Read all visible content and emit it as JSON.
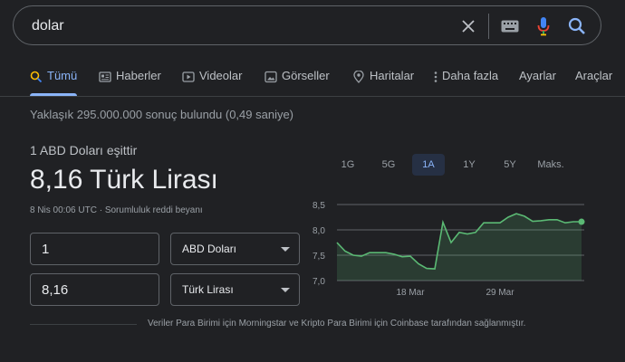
{
  "search": {
    "query": "dolar"
  },
  "tabs": [
    {
      "label": "Tümü",
      "icon": "search-icon",
      "active": true
    },
    {
      "label": "Haberler",
      "icon": "news-icon",
      "active": false
    },
    {
      "label": "Videolar",
      "icon": "video-icon",
      "active": false
    },
    {
      "label": "Görseller",
      "icon": "image-icon",
      "active": false
    },
    {
      "label": "Haritalar",
      "icon": "map-pin-icon",
      "active": false
    },
    {
      "label": "Daha fazla",
      "icon": "more-vertical-icon",
      "active": false
    },
    {
      "label": "Ayarlar",
      "icon": null,
      "active": false
    },
    {
      "label": "Araçlar",
      "icon": null,
      "active": false
    }
  ],
  "stats": "Yaklaşık 295.000.000 sonuç bulundu (0,49 saniye)",
  "converter": {
    "label": "1 ABD Doları eşittir",
    "result": "8,16 Türk Lirası",
    "timestamp": "8 Nis 00:06 UTC",
    "separator": "·",
    "disclaimer": "Sorumluluk reddi beyanı",
    "from_amount": "1",
    "from_currency": "ABD Doları",
    "to_amount": "8,16",
    "to_currency": "Türk Lirası"
  },
  "ranges": [
    {
      "label": "1G",
      "active": false
    },
    {
      "label": "5G",
      "active": false
    },
    {
      "label": "1A",
      "active": true
    },
    {
      "label": "1Y",
      "active": false
    },
    {
      "label": "5Y",
      "active": false
    },
    {
      "label": "Maks.",
      "active": false
    }
  ],
  "attribution": "Veriler Para Birimi için Morningstar ve Kripto Para Birimi için Coinbase tarafından sağlanmıştır.",
  "colors": {
    "accent": "#8ab4f8",
    "line": "#5bb974",
    "background": "#202124"
  },
  "chart_data": {
    "type": "area",
    "title": "",
    "xlabel": "",
    "ylabel": "",
    "ylim": [
      7.0,
      8.5
    ],
    "yticks": [
      8.5,
      8.0,
      7.5,
      7.0
    ],
    "ytick_labels": [
      "8,5",
      "8,0",
      "7,5",
      "7,0"
    ],
    "xticks": [
      {
        "label": "18 Mar",
        "at": 9
      },
      {
        "label": "29 Mar",
        "at": 20
      }
    ],
    "grid": true,
    "legend": "none",
    "series": [
      {
        "values": [
          7.75,
          7.58,
          7.5,
          7.48,
          7.55,
          7.55,
          7.55,
          7.52,
          7.47,
          7.48,
          7.33,
          7.24,
          7.23,
          8.15,
          7.75,
          7.95,
          7.92,
          7.95,
          8.14,
          8.14,
          8.14,
          8.25,
          8.32,
          8.27,
          8.17,
          8.18,
          8.2,
          8.2,
          8.14,
          8.16,
          8.16
        ]
      }
    ]
  }
}
